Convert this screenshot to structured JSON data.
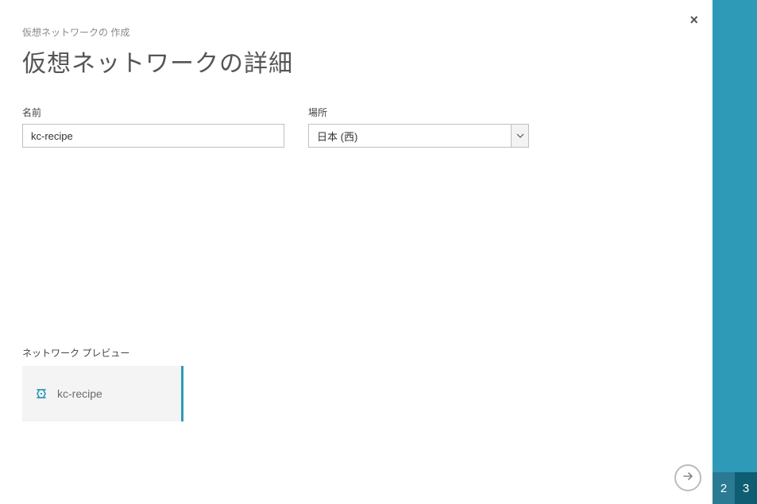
{
  "breadcrumb": "仮想ネットワークの 作成",
  "page_title": "仮想ネットワークの詳細",
  "form": {
    "name": {
      "label": "名前",
      "value": "kc-recipe"
    },
    "location": {
      "label": "場所",
      "selected": "日本 (西)"
    }
  },
  "preview": {
    "label": "ネットワーク プレビュー",
    "name": "kc-recipe"
  },
  "steps": {
    "step2": "2",
    "step3": "3"
  },
  "icons": {
    "close": "×",
    "network": "network-icon",
    "next": "arrow-right-icon",
    "caret": "chevron-down-icon"
  },
  "colors": {
    "accent": "#2e9ab7",
    "step2_bg": "#2a7a93",
    "step3_bg": "#0f5d73"
  }
}
